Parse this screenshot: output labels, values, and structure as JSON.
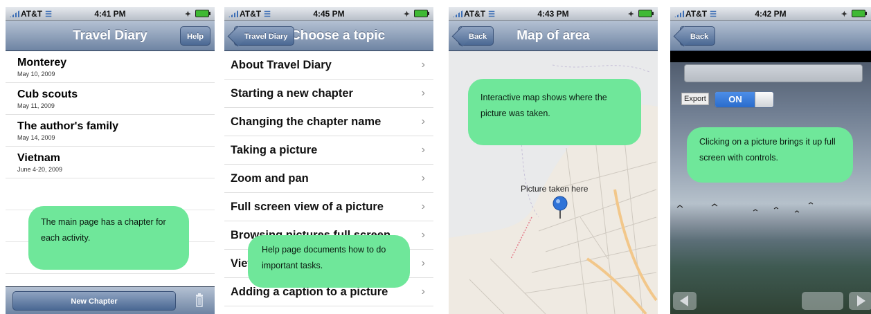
{
  "colors": {
    "nav_gradient_top": "#b4c1d3",
    "nav_gradient_bottom": "#6e84a3",
    "bubble": "#6fe79a",
    "switch_on": "#2a6ccc"
  },
  "screens": [
    {
      "status": {
        "carrier": "AT&T",
        "time": "4:41 PM"
      },
      "title": "Travel Diary",
      "right_button": "Help",
      "chapters": [
        {
          "title": "Monterey",
          "date": "May 10, 2009"
        },
        {
          "title": "Cub scouts",
          "date": "May 11, 2009"
        },
        {
          "title": "The author's family",
          "date": "May 14, 2009"
        },
        {
          "title": "Vietnam",
          "date": "June 4-20, 2009"
        }
      ],
      "toolbar_button": "New Chapter",
      "toolbar_icon": "trash-icon",
      "callout": "The main page has a chapter for each activity."
    },
    {
      "status": {
        "carrier": "AT&T",
        "time": "4:45 PM"
      },
      "title": "Choose a topic",
      "back_button": "Travel Diary",
      "topics": [
        "About Travel Diary",
        "Starting a new chapter",
        "Changing the chapter name",
        "Taking a picture",
        "Zoom and pan",
        "Full screen view of a picture",
        "Browsing pictures full screen",
        "View",
        "Adding a caption to a picture"
      ],
      "callout": "Help page documents how to do important tasks."
    },
    {
      "status": {
        "carrier": "AT&T",
        "time": "4:43 PM"
      },
      "title": "Map of area",
      "back_button": "Back",
      "pin_label": "Picture taken here",
      "callout": "Interactive map shows where the picture was taken."
    },
    {
      "status": {
        "carrier": "AT&T",
        "time": "4:42 PM"
      },
      "back_button": "Back",
      "export_label": "Export",
      "switch_state": "ON",
      "callout": "Clicking on a picture brings it up full screen with controls."
    }
  ]
}
